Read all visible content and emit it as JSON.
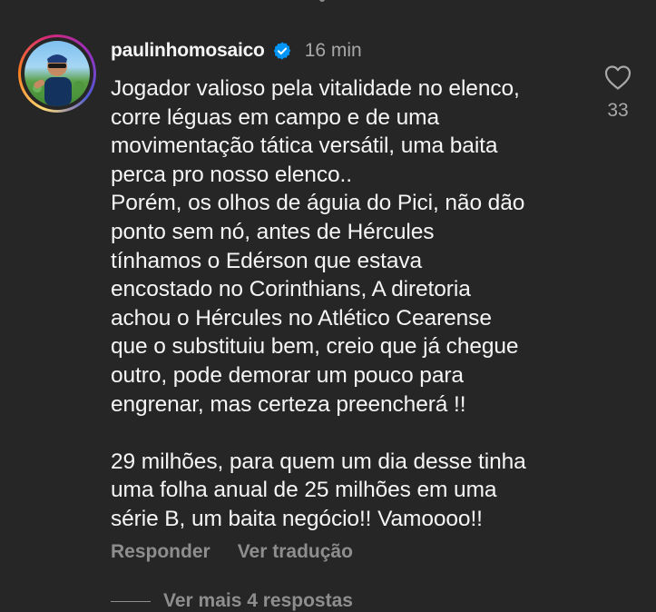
{
  "comment": {
    "username": "paulinhomosaico",
    "verified_icon": "verified-badge-icon",
    "time": "16 min",
    "text": "Jogador valioso pela vitalidade no elenco,\ncorre léguas em campo e de uma\nmovimentação tática versátil, uma baita\nperca pro nosso elenco..\nPorém, os olhos de águia do Pici, não dão\nponto sem nó, antes de Hércules\ntínhamos o Edérson que estava\nencostado no Corinthians, A diretoria\nachou o Hércules no Atlético Cearense\nque o substituiu bem, creio que já chegue\noutro, pode demorar um pouco para\nengrenar, mas certeza preencherá !!\n\n29 milhões, para quem um dia desse tinha\numa folha anual de 25 milhões em uma\nsérie B, um baita negócio!! Vamoooo!!",
    "actions": {
      "reply": "Responder",
      "translate": "Ver tradução"
    },
    "likes": {
      "icon": "heart-outline-icon",
      "count": "33"
    },
    "more_replies": "Ver mais 4 respostas"
  },
  "colors": {
    "background": "#262626",
    "text_primary": "#f5f5f5",
    "text_secondary": "#a8a8a8",
    "verified_blue": "#0095f6"
  }
}
